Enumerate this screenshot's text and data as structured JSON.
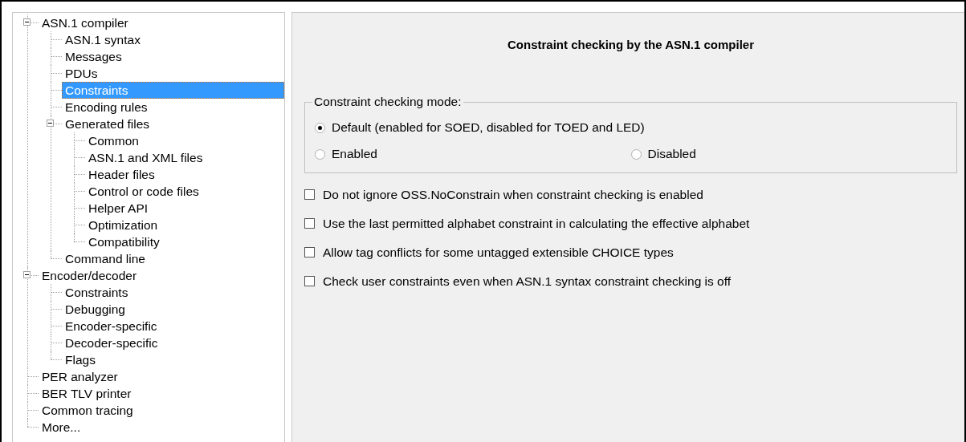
{
  "tree": [
    {
      "label": "ASN.1 compiler",
      "expanded": true,
      "selected": false,
      "children": [
        {
          "label": "ASN.1 syntax",
          "selected": false
        },
        {
          "label": "Messages",
          "selected": false
        },
        {
          "label": "PDUs",
          "selected": false
        },
        {
          "label": "Constraints",
          "selected": true
        },
        {
          "label": "Encoding rules",
          "selected": false
        },
        {
          "label": "Generated files",
          "expanded": true,
          "selected": false,
          "children": [
            {
              "label": "Common",
              "selected": false
            },
            {
              "label": "ASN.1 and XML files",
              "selected": false
            },
            {
              "label": "Header files",
              "selected": false
            },
            {
              "label": "Control or code files",
              "selected": false
            },
            {
              "label": "Helper API",
              "selected": false
            },
            {
              "label": "Optimization",
              "selected": false
            },
            {
              "label": "Compatibility",
              "selected": false
            }
          ]
        },
        {
          "label": "Command line",
          "selected": false
        }
      ]
    },
    {
      "label": "Encoder/decoder",
      "expanded": true,
      "selected": false,
      "children": [
        {
          "label": "Constraints",
          "selected": false
        },
        {
          "label": "Debugging",
          "selected": false
        },
        {
          "label": "Encoder-specific",
          "selected": false
        },
        {
          "label": "Decoder-specific",
          "selected": false
        },
        {
          "label": "Flags",
          "selected": false
        }
      ]
    },
    {
      "label": "PER analyzer",
      "selected": false
    },
    {
      "label": "BER TLV printer",
      "selected": false
    },
    {
      "label": "Common tracing",
      "selected": false
    },
    {
      "label": "More...",
      "selected": false
    }
  ],
  "panel": {
    "title": "Constraint checking by the ASN.1 compiler",
    "mode_group": {
      "legend": "Constraint checking mode:",
      "options": [
        {
          "label": "Default (enabled for SOED, disabled for TOED and LED)",
          "selected": true
        },
        {
          "label": "Enabled",
          "selected": false
        },
        {
          "label": "Disabled",
          "selected": false
        }
      ]
    },
    "checkboxes": [
      {
        "label": "Do not ignore OSS.NoConstrain when constraint checking is enabled",
        "checked": false
      },
      {
        "label": "Use the last permitted alphabet constraint in calculating the effective alphabet",
        "checked": false
      },
      {
        "label": "Allow tag conflicts for some untagged extensible CHOICE types",
        "checked": false
      },
      {
        "label": "Check user constraints even when ASN.1 syntax constraint checking is off",
        "checked": false
      }
    ]
  }
}
